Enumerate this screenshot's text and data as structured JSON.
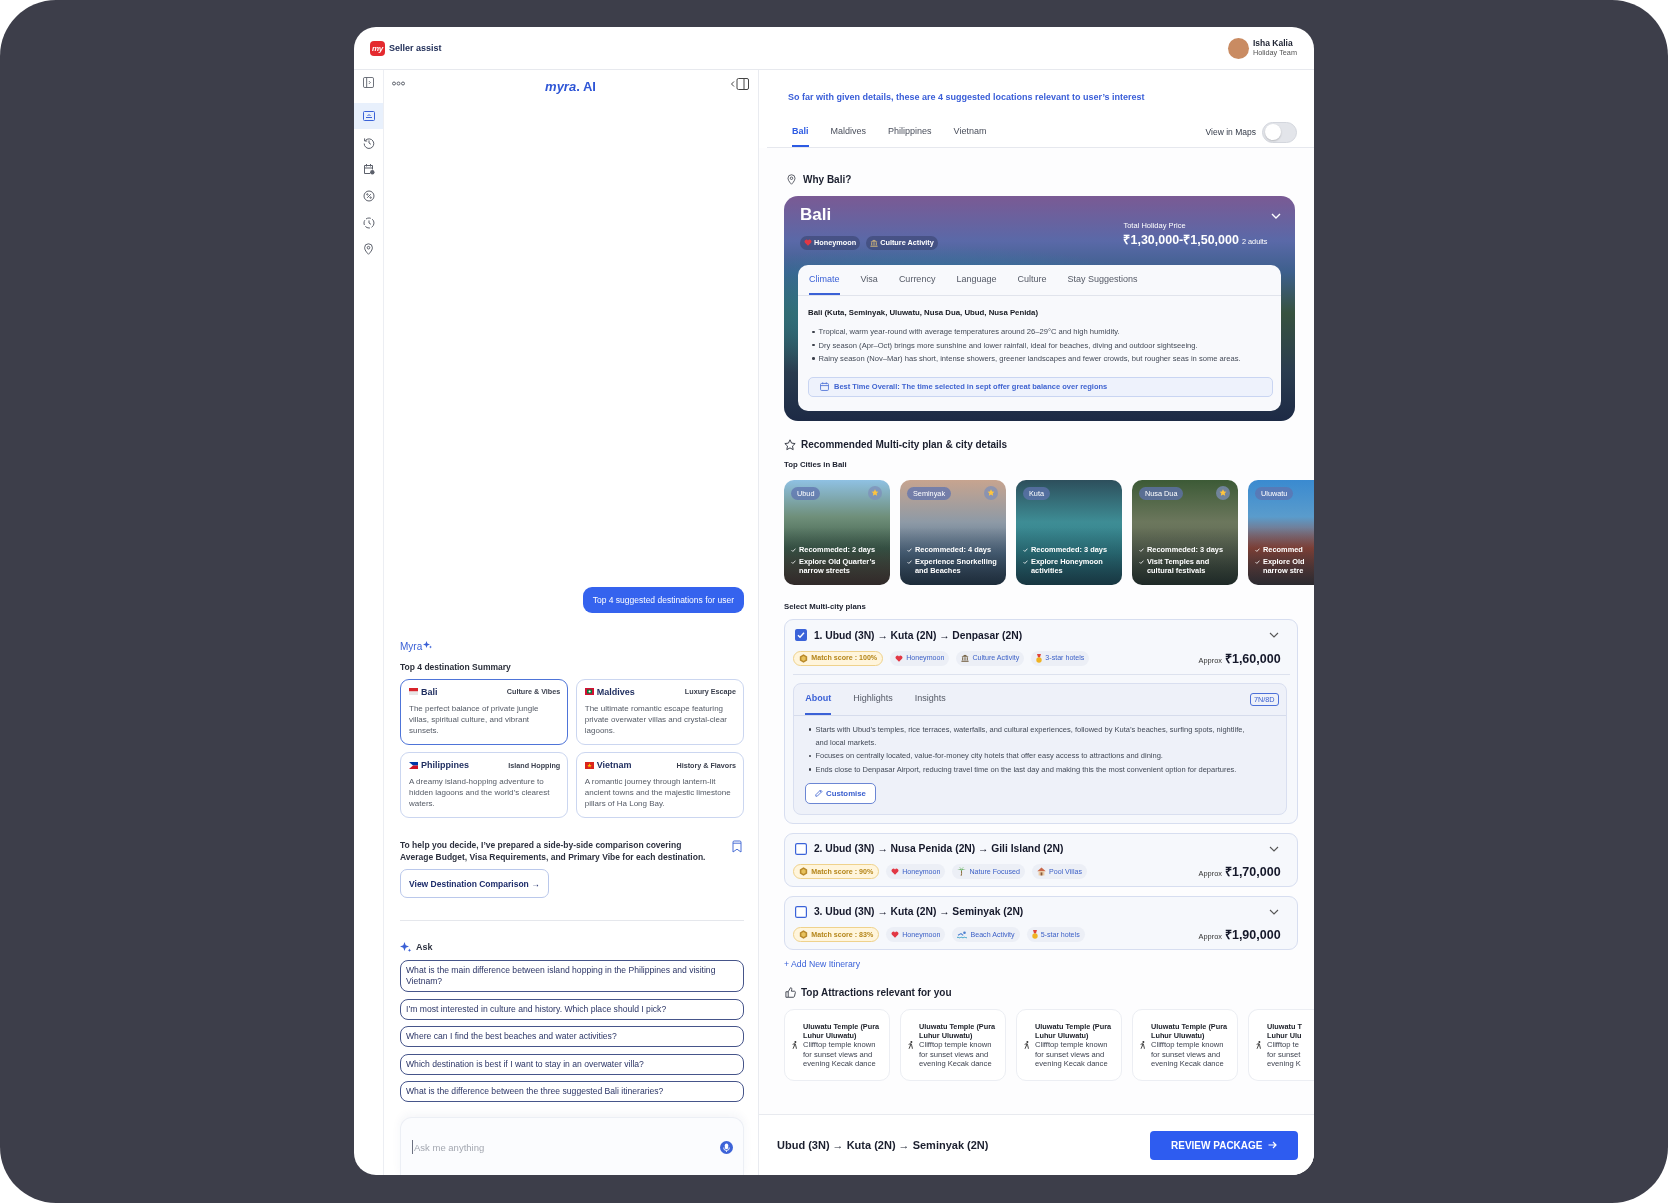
{
  "top_bar": {
    "logo_mark": "my",
    "brand": "Seller assist",
    "user": {
      "name": "Isha Kalia",
      "team": "Holiday Team"
    }
  },
  "rail": [
    {
      "selected": false
    },
    {
      "selected": true
    },
    {
      "selected": false
    },
    {
      "selected": false
    },
    {
      "selected": false
    },
    {
      "selected": false
    },
    {
      "selected": false
    }
  ],
  "chat": {
    "logo": "*myra*. AI",
    "user_message": "Top 4 suggested destinations for user",
    "assistant_name": "Myra",
    "summary_title": "Top 4 destination Summary",
    "destinations": [
      {
        "name": "Bali",
        "vibe": "Culture & Vibes",
        "description": "The perfect balance of private jungle villas, spiritual culture, and vibrant sunsets.",
        "selected": true
      },
      {
        "name": "Maldives",
        "vibe": "Luxury Escape",
        "description": "The ultimate romantic escape featuring private overwater villas and crystal-clear lagoons.",
        "selected": false
      },
      {
        "name": "Philippines",
        "vibe": "Island Hopping",
        "description": "A dreamy island-hopping adventure to hidden lagoons and the world’s clearest waters.",
        "selected": false
      },
      {
        "name": "Vietnam",
        "vibe": "History & Flavors",
        "description": "A romantic journey through lantern-lit ancient towns and the majestic limestone pillars of Ha Long Bay.",
        "selected": false
      }
    ],
    "comparison_note": "To help you decide, I’ve prepared a side-by-side comparison covering Average Budget, Visa Requirements, and Primary Vibe for each destination.",
    "comparison_button": "View Destination Comparison →",
    "ask_title": "Ask",
    "questions": [
      "What is the main difference between island hopping in the Philippines and visiting Vietnam?",
      "I’m most interested in culture and history. Which place should I pick?",
      "Where can I find the best beaches and water activities?",
      "Which destination is best if I want to stay in an overwater villa?",
      "What is the difference between the three suggested Bali itineraries?"
    ],
    "input": {
      "placeholder": "Ask me anything"
    }
  },
  "results": {
    "intro": "So far with given details, these are 4 suggested locations relevant to user’s interest",
    "tabs": [
      {
        "label": "Bali",
        "selected": true
      },
      {
        "label": "Maldives",
        "selected": false
      },
      {
        "label": "Philippines",
        "selected": false
      },
      {
        "label": "Vietnam",
        "selected": false
      }
    ],
    "map_toggle": {
      "label": "View in Maps",
      "on": false
    },
    "why_title": "Why Bali?",
    "hero": {
      "name": "Bali",
      "tags": [
        {
          "kind": "romance",
          "label": "Honeymoon"
        },
        {
          "kind": "culture",
          "label": "Culture Activity"
        }
      ],
      "price_caption": "Total Holiday Price",
      "price": "₹1,30,000-₹1,50,000",
      "travellers": "2 adults",
      "tabs": [
        {
          "label": "Climate",
          "selected": true
        },
        {
          "label": "Visa",
          "selected": false
        },
        {
          "label": "Currency",
          "selected": false
        },
        {
          "label": "Language",
          "selected": false
        },
        {
          "label": "Culture",
          "selected": false
        },
        {
          "label": "Stay Suggestions",
          "selected": false
        }
      ],
      "heading": "Bali (Kuta, Seminyak, Uluwatu, Nusa Dua, Ubud, Nusa Penida)",
      "bullets": [
        "Tropical, warm year-round with average temperatures around 26–29°C and high humidity.",
        "Dry season (Apr–Oct) brings more sunshine and lower rainfall, ideal for beaches, diving and outdoor sightseeing.",
        "Rainy season (Nov–Mar) has short, intense showers, greener landscapes and fewer crowds, but rougher seas in some areas."
      ],
      "best_time": "Best Time Overall: The time selected in sept offer great balance over regions"
    },
    "plan_section_title": "Recommended Multi-city plan & city details",
    "cities_title": "Top Cities in Bali",
    "cities": [
      {
        "name": "Ubud",
        "starred": true,
        "points": [
          "Recommeded: 2 days",
          "Explore Old Quarter’s narrow streets"
        ]
      },
      {
        "name": "Seminyak",
        "starred": true,
        "points": [
          "Recommeded: 4 days",
          "Experience Snorkelling and Beaches"
        ]
      },
      {
        "name": "Kuta",
        "starred": false,
        "points": [
          "Recommeded: 3 days",
          "Explore Honeymoon activities"
        ]
      },
      {
        "name": "Nusa Dua",
        "starred": true,
        "points": [
          "Recommeded: 3 days",
          "Visit Temples and cultural festivals"
        ]
      },
      {
        "name": "Uluwatu",
        "starred": false,
        "points": [
          "Recommed",
          "Explore Old narrow stre"
        ]
      }
    ],
    "plans_title": "Select Multi-city plans",
    "plans": [
      {
        "title": "1. Ubud (3N) → Kuta (2N) → Denpasar (2N)",
        "checked": true,
        "expanded": true,
        "tags": [
          {
            "kind": "score",
            "label": "Match score : 100%"
          },
          {
            "kind": "romance",
            "label": "Honeymoon"
          },
          {
            "kind": "culture",
            "label": "Culture Activity"
          },
          {
            "kind": "hotel",
            "label": "3-star hotels"
          }
        ],
        "price_label": "Approx",
        "price": "₹1,60,000",
        "details": {
          "tabs": [
            {
              "label": "About",
              "selected": true
            },
            {
              "label": "Highlights",
              "selected": false
            },
            {
              "label": "Insights",
              "selected": false
            }
          ],
          "duration": "7N/8D",
          "bullets": [
            "Starts with Ubud’s temples, rice terraces, waterfalls, and cultural experiences, followed by Kuta’s beaches, surfing spots, nightlife, and local markets.",
            "Focuses on centrally located, value-for-money city hotels that offer easy access to attractions and dining.",
            "Ends close to Denpasar Airport, reducing travel time on the last day and making this the most convenient option for departures."
          ],
          "button": "Customise"
        }
      },
      {
        "title": "2. Ubud (3N) → Nusa Penida (2N) → Gili Island (2N)",
        "checked": false,
        "expanded": false,
        "tags": [
          {
            "kind": "score",
            "label": "Match score : 90%"
          },
          {
            "kind": "romance",
            "label": "Honeymoon"
          },
          {
            "kind": "nature",
            "label": "Nature Focused"
          },
          {
            "kind": "villa",
            "label": "Pool Villas"
          }
        ],
        "price_label": "Approx",
        "price": "₹1,70,000"
      },
      {
        "title": "3. Ubud (3N) → Kuta (2N) → Seminyak (2N)",
        "checked": false,
        "expanded": false,
        "tags": [
          {
            "kind": "score",
            "label": "Match score : 83%"
          },
          {
            "kind": "romance",
            "label": "Honeymoon"
          },
          {
            "kind": "beach",
            "label": "Beach Activity"
          },
          {
            "kind": "hotel",
            "label": "5-star hotels"
          }
        ],
        "price_label": "Approx",
        "price": "₹1,90,000"
      }
    ],
    "add_itinerary": "+ Add New Itinerary",
    "attractions_title": "Top Attractions relevant for you",
    "attractions": [
      {
        "title": "Uluwatu Temple (Pura Luhur Uluwatu)",
        "description": "Clifftop temple known for sunset views and evening Kecak dance"
      },
      {
        "title": "Uluwatu Temple (Pura Luhur Uluwatu)",
        "description": "Clifftop temple known for sunset views and evening Kecak dance"
      },
      {
        "title": "Uluwatu Temple (Pura Luhur Uluwatu)",
        "description": "Clifftop temple known for sunset views and evening Kecak dance"
      },
      {
        "title": "Uluwatu Temple (Pura Luhur Uluwatu)",
        "description": "Clifftop temple known for sunset views and evening Kecak dance"
      },
      {
        "title": "Uluwatu T Luhur Ulu",
        "description": "Clifftop te for sunset evening K"
      }
    ]
  },
  "footer": {
    "route": "Ubud (3N) → Kuta (2N) → Seminyak (2N)",
    "button": "REVIEW PACKAGE"
  }
}
